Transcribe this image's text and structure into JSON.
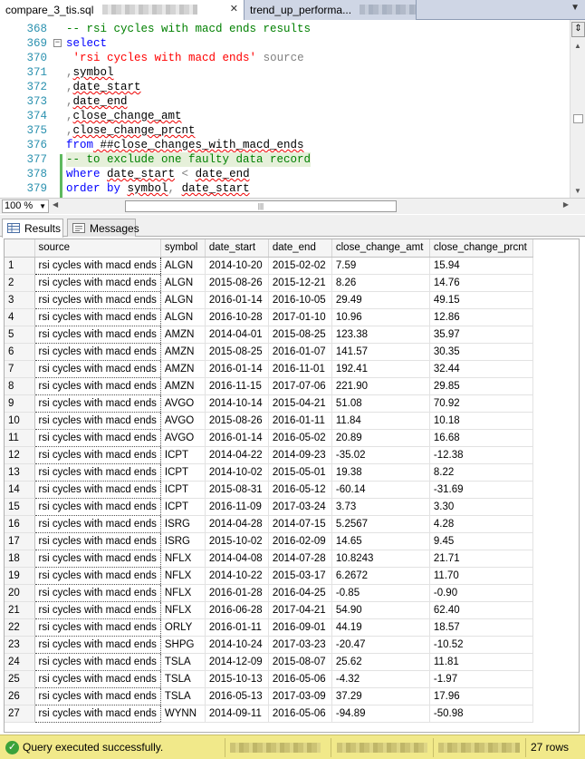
{
  "tabs": [
    {
      "label": "compare_3_tis.sql",
      "active": true
    },
    {
      "label": "trend_up_performa...",
      "active": false
    }
  ],
  "editor": {
    "lines": [
      {
        "num": "368",
        "segments": [
          {
            "t": "-- rsi cycles with macd ends results",
            "c": "cm"
          }
        ]
      },
      {
        "num": "369",
        "segments": [
          {
            "t": "select",
            "c": "kw"
          }
        ]
      },
      {
        "num": "370",
        "segments": [
          {
            "t": " ",
            "c": ""
          },
          {
            "t": "'rsi cycles with macd ends'",
            "c": "str"
          },
          {
            "t": " source",
            "c": "gr"
          }
        ]
      },
      {
        "num": "371",
        "segments": [
          {
            "t": ",",
            "c": "gr"
          },
          {
            "t": "symbol",
            "c": "sq"
          }
        ]
      },
      {
        "num": "372",
        "segments": [
          {
            "t": ",",
            "c": "gr"
          },
          {
            "t": "date_start",
            "c": "sq"
          }
        ]
      },
      {
        "num": "373",
        "segments": [
          {
            "t": ",",
            "c": "gr"
          },
          {
            "t": "date_end",
            "c": "sq"
          }
        ]
      },
      {
        "num": "374",
        "segments": [
          {
            "t": ",",
            "c": "gr"
          },
          {
            "t": "close_change_amt",
            "c": "sq"
          }
        ]
      },
      {
        "num": "375",
        "segments": [
          {
            "t": ",",
            "c": "gr"
          },
          {
            "t": "close_change_prcnt",
            "c": "sq"
          }
        ]
      },
      {
        "num": "376",
        "segments": [
          {
            "t": "from",
            "c": "kw"
          },
          {
            "t": " ##close_changes_with_macd_ends",
            "c": "sq"
          }
        ]
      },
      {
        "num": "377",
        "segments": [
          {
            "t": "-- to exclude one faulty data record",
            "c": "cm"
          }
        ]
      },
      {
        "num": "378",
        "segments": [
          {
            "t": "where",
            "c": "kw"
          },
          {
            "t": " ",
            "c": ""
          },
          {
            "t": "date_start",
            "c": "sq"
          },
          {
            "t": " < ",
            "c": "gr"
          },
          {
            "t": "date_end",
            "c": "sq"
          }
        ]
      },
      {
        "num": "379",
        "segments": [
          {
            "t": "order by",
            "c": "kw"
          },
          {
            "t": " ",
            "c": ""
          },
          {
            "t": "symbol",
            "c": "sq"
          },
          {
            "t": ", ",
            "c": "gr"
          },
          {
            "t": "date_start",
            "c": "sq"
          }
        ]
      }
    ],
    "zoom": "100 %"
  },
  "results_tabs": {
    "results": "Results",
    "messages": "Messages"
  },
  "grid": {
    "columns": [
      "source",
      "symbol",
      "date_start",
      "date_end",
      "close_change_amt",
      "close_change_prcnt"
    ],
    "rows": [
      [
        "1",
        "rsi cycles with macd ends",
        "ALGN",
        "2014-10-20",
        "2015-02-02",
        "7.59",
        "15.94"
      ],
      [
        "2",
        "rsi cycles with macd ends",
        "ALGN",
        "2015-08-26",
        "2015-12-21",
        "8.26",
        "14.76"
      ],
      [
        "3",
        "rsi cycles with macd ends",
        "ALGN",
        "2016-01-14",
        "2016-10-05",
        "29.49",
        "49.15"
      ],
      [
        "4",
        "rsi cycles with macd ends",
        "ALGN",
        "2016-10-28",
        "2017-01-10",
        "10.96",
        "12.86"
      ],
      [
        "5",
        "rsi cycles with macd ends",
        "AMZN",
        "2014-04-01",
        "2015-08-25",
        "123.38",
        "35.97"
      ],
      [
        "6",
        "rsi cycles with macd ends",
        "AMZN",
        "2015-08-25",
        "2016-01-07",
        "141.57",
        "30.35"
      ],
      [
        "7",
        "rsi cycles with macd ends",
        "AMZN",
        "2016-01-14",
        "2016-11-01",
        "192.41",
        "32.44"
      ],
      [
        "8",
        "rsi cycles with macd ends",
        "AMZN",
        "2016-11-15",
        "2017-07-06",
        "221.90",
        "29.85"
      ],
      [
        "9",
        "rsi cycles with macd ends",
        "AVGO",
        "2014-10-14",
        "2015-04-21",
        "51.08",
        "70.92"
      ],
      [
        "10",
        "rsi cycles with macd ends",
        "AVGO",
        "2015-08-26",
        "2016-01-11",
        "11.84",
        "10.18"
      ],
      [
        "11",
        "rsi cycles with macd ends",
        "AVGO",
        "2016-01-14",
        "2016-05-02",
        "20.89",
        "16.68"
      ],
      [
        "12",
        "rsi cycles with macd ends",
        "ICPT",
        "2014-04-22",
        "2014-09-23",
        "-35.02",
        "-12.38"
      ],
      [
        "13",
        "rsi cycles with macd ends",
        "ICPT",
        "2014-10-02",
        "2015-05-01",
        "19.38",
        "8.22"
      ],
      [
        "14",
        "rsi cycles with macd ends",
        "ICPT",
        "2015-08-31",
        "2016-05-12",
        "-60.14",
        "-31.69"
      ],
      [
        "15",
        "rsi cycles with macd ends",
        "ICPT",
        "2016-11-09",
        "2017-03-24",
        "3.73",
        "3.30"
      ],
      [
        "16",
        "rsi cycles with macd ends",
        "ISRG",
        "2014-04-28",
        "2014-07-15",
        "5.2567",
        "4.28"
      ],
      [
        "17",
        "rsi cycles with macd ends",
        "ISRG",
        "2015-10-02",
        "2016-02-09",
        "14.65",
        "9.45"
      ],
      [
        "18",
        "rsi cycles with macd ends",
        "NFLX",
        "2014-04-08",
        "2014-07-28",
        "10.8243",
        "21.71"
      ],
      [
        "19",
        "rsi cycles with macd ends",
        "NFLX",
        "2014-10-22",
        "2015-03-17",
        "6.2672",
        "11.70"
      ],
      [
        "20",
        "rsi cycles with macd ends",
        "NFLX",
        "2016-01-28",
        "2016-04-25",
        "-0.85",
        "-0.90"
      ],
      [
        "21",
        "rsi cycles with macd ends",
        "NFLX",
        "2016-06-28",
        "2017-04-21",
        "54.90",
        "62.40"
      ],
      [
        "22",
        "rsi cycles with macd ends",
        "ORLY",
        "2016-01-11",
        "2016-09-01",
        "44.19",
        "18.57"
      ],
      [
        "23",
        "rsi cycles with macd ends",
        "SHPG",
        "2014-10-24",
        "2017-03-23",
        "-20.47",
        "-10.52"
      ],
      [
        "24",
        "rsi cycles with macd ends",
        "TSLA",
        "2014-12-09",
        "2015-08-07",
        "25.62",
        "11.81"
      ],
      [
        "25",
        "rsi cycles with macd ends",
        "TSLA",
        "2015-10-13",
        "2016-05-06",
        "-4.32",
        "-1.97"
      ],
      [
        "26",
        "rsi cycles with macd ends",
        "TSLA",
        "2016-05-13",
        "2017-03-09",
        "37.29",
        "17.96"
      ],
      [
        "27",
        "rsi cycles with macd ends",
        "WYNN",
        "2014-09-11",
        "2016-05-06",
        "-94.89",
        "-50.98"
      ]
    ]
  },
  "status": {
    "message": "Query executed successfully.",
    "row_count": "27 rows",
    "bar_color": "#f1e98a",
    "ok_color": "#3aa23a"
  }
}
